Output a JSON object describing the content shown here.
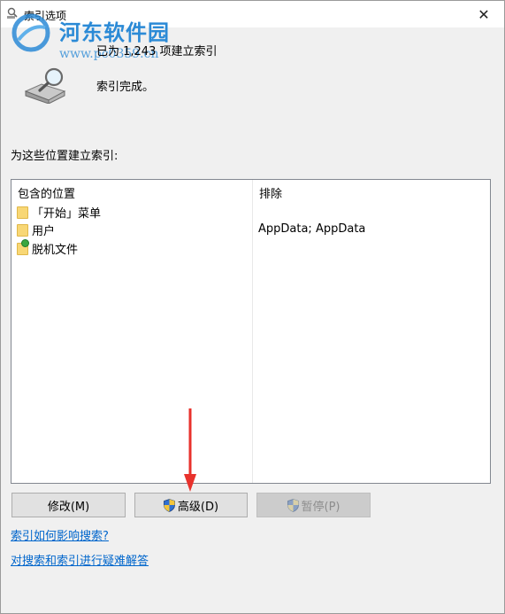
{
  "window": {
    "title": "索引选项",
    "close_glyph": "✕"
  },
  "watermark": {
    "site_name": "河东软件园",
    "url": "www.pc0359.cn"
  },
  "status": {
    "count_text": "已为 1,243 项建立索引",
    "done_text": "索引完成。"
  },
  "locations": {
    "label": "为这些位置建立索引:",
    "headers": {
      "included": "包含的位置",
      "excluded": "排除"
    },
    "rows": [
      {
        "name": "「开始」菜单",
        "icon": "folder-icon",
        "excluded": ""
      },
      {
        "name": "用户",
        "icon": "folder-icon",
        "excluded": "AppData; AppData"
      },
      {
        "name": "脱机文件",
        "icon": "offline-folder-icon",
        "excluded": ""
      }
    ]
  },
  "buttons": {
    "modify": "修改(M)",
    "advanced": "高级(D)",
    "pause": "暂停(P)"
  },
  "links": {
    "how_indexing": "索引如何影响搜索?",
    "troubleshoot": "对搜索和索引进行疑难解答"
  },
  "colors": {
    "accent": "#0066cc",
    "annotation_arrow": "#e8322c",
    "folder": "#f8d775"
  }
}
